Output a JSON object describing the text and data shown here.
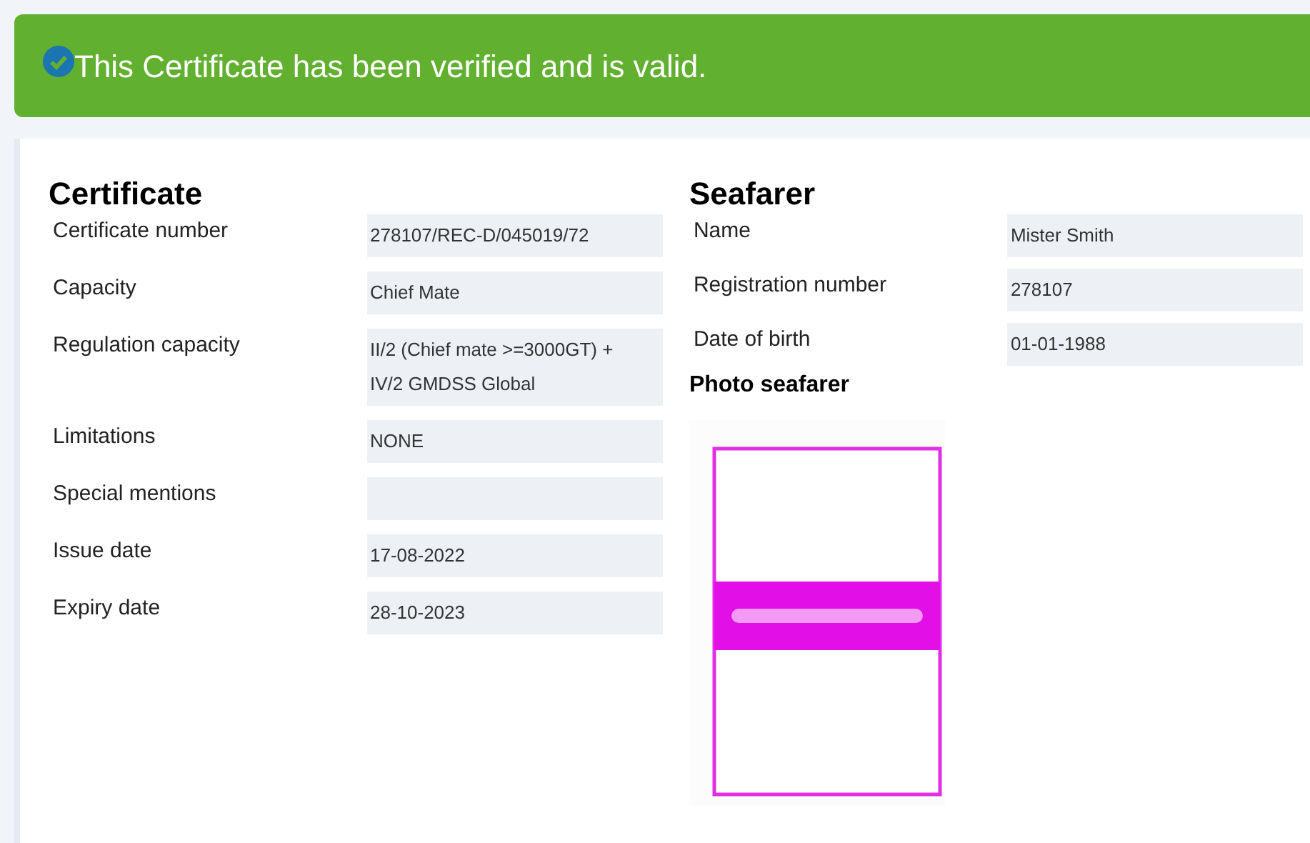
{
  "alert": {
    "text": "This Certificate has been verified and is valid."
  },
  "certificate": {
    "title": "Certificate",
    "fields": [
      {
        "label": "Certificate number",
        "value": "278107/REC-D/045019/72"
      },
      {
        "label": "Capacity",
        "value": "Chief Mate"
      },
      {
        "label": "Regulation capacity",
        "value": "II/2 (Chief mate >=3000GT) + IV/2 GMDSS Global"
      },
      {
        "label": "Limitations",
        "value": "NONE"
      },
      {
        "label": "Special mentions"
      },
      {
        "label": "Issue date",
        "value": "17-08-2022"
      },
      {
        "label": "Expiry date",
        "value": "28-10-2023"
      }
    ]
  },
  "seafarer": {
    "title": "Seafarer",
    "fields": [
      {
        "label": "Name",
        "value": "Mister Smith"
      },
      {
        "label": "Registration number",
        "value": "278107"
      },
      {
        "label": "Date of birth",
        "value": "01-01-1988"
      }
    ],
    "photo": {
      "title": "Photo seafarer"
    }
  }
}
